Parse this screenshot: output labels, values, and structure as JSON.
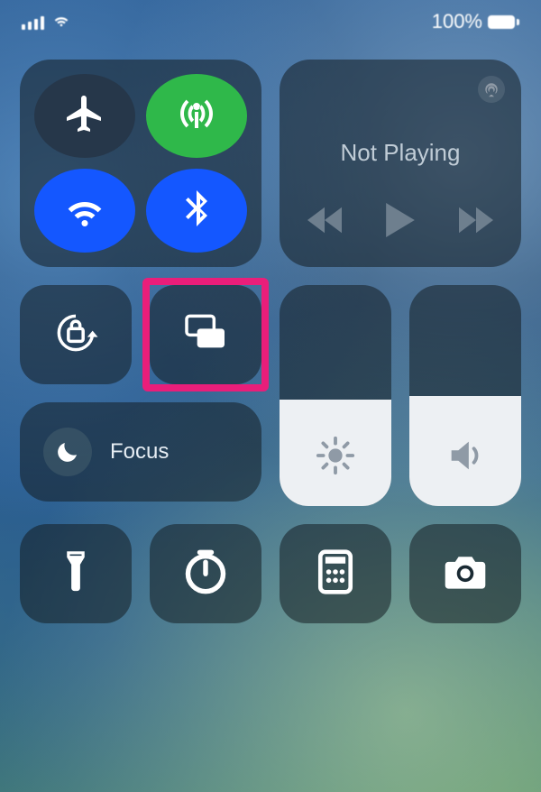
{
  "status": {
    "battery_text": "100%"
  },
  "media": {
    "title": "Not Playing"
  },
  "focus": {
    "label": "Focus"
  },
  "sliders": {
    "brightness_percent": 48,
    "volume_percent": 50
  },
  "connectivity": {
    "airplane": false,
    "cellular": true,
    "wifi": true,
    "bluetooth": true
  },
  "highlighted_control": "screen-mirroring",
  "icons": {
    "airplane": "airplane-icon",
    "cellular": "antenna-icon",
    "wifi": "wifi-icon",
    "bluetooth": "bluetooth-icon",
    "orientation_lock": "lock-rotate-icon",
    "screen_mirror": "screen-mirror-icon",
    "moon": "moon-icon",
    "brightness": "sun-icon",
    "volume": "speaker-icon",
    "flashlight": "flashlight-icon",
    "timer": "timer-icon",
    "calculator": "calculator-icon",
    "camera": "camera-icon",
    "airplay": "airplay-icon",
    "rewind": "rewind-icon",
    "play": "play-icon",
    "forward": "forward-icon"
  }
}
